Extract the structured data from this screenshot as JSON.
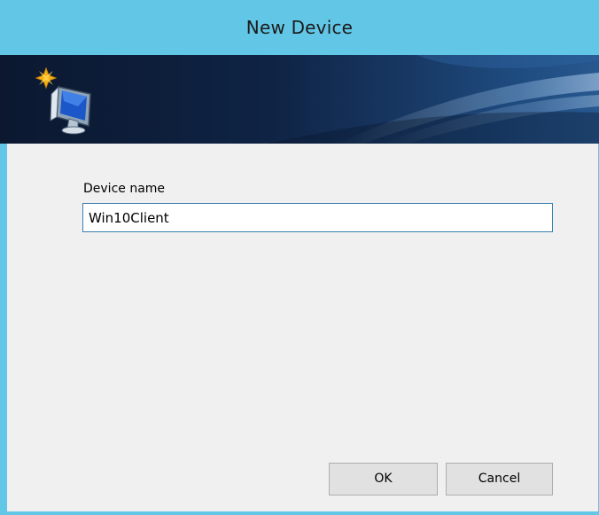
{
  "window": {
    "title": "New Device",
    "frame_color": "#62c6e6"
  },
  "banner": {
    "icon": "new-computer-icon"
  },
  "form": {
    "device_name_label": "Device name",
    "device_name_value": "Win10Client"
  },
  "buttons": {
    "ok_label": "OK",
    "cancel_label": "Cancel"
  }
}
